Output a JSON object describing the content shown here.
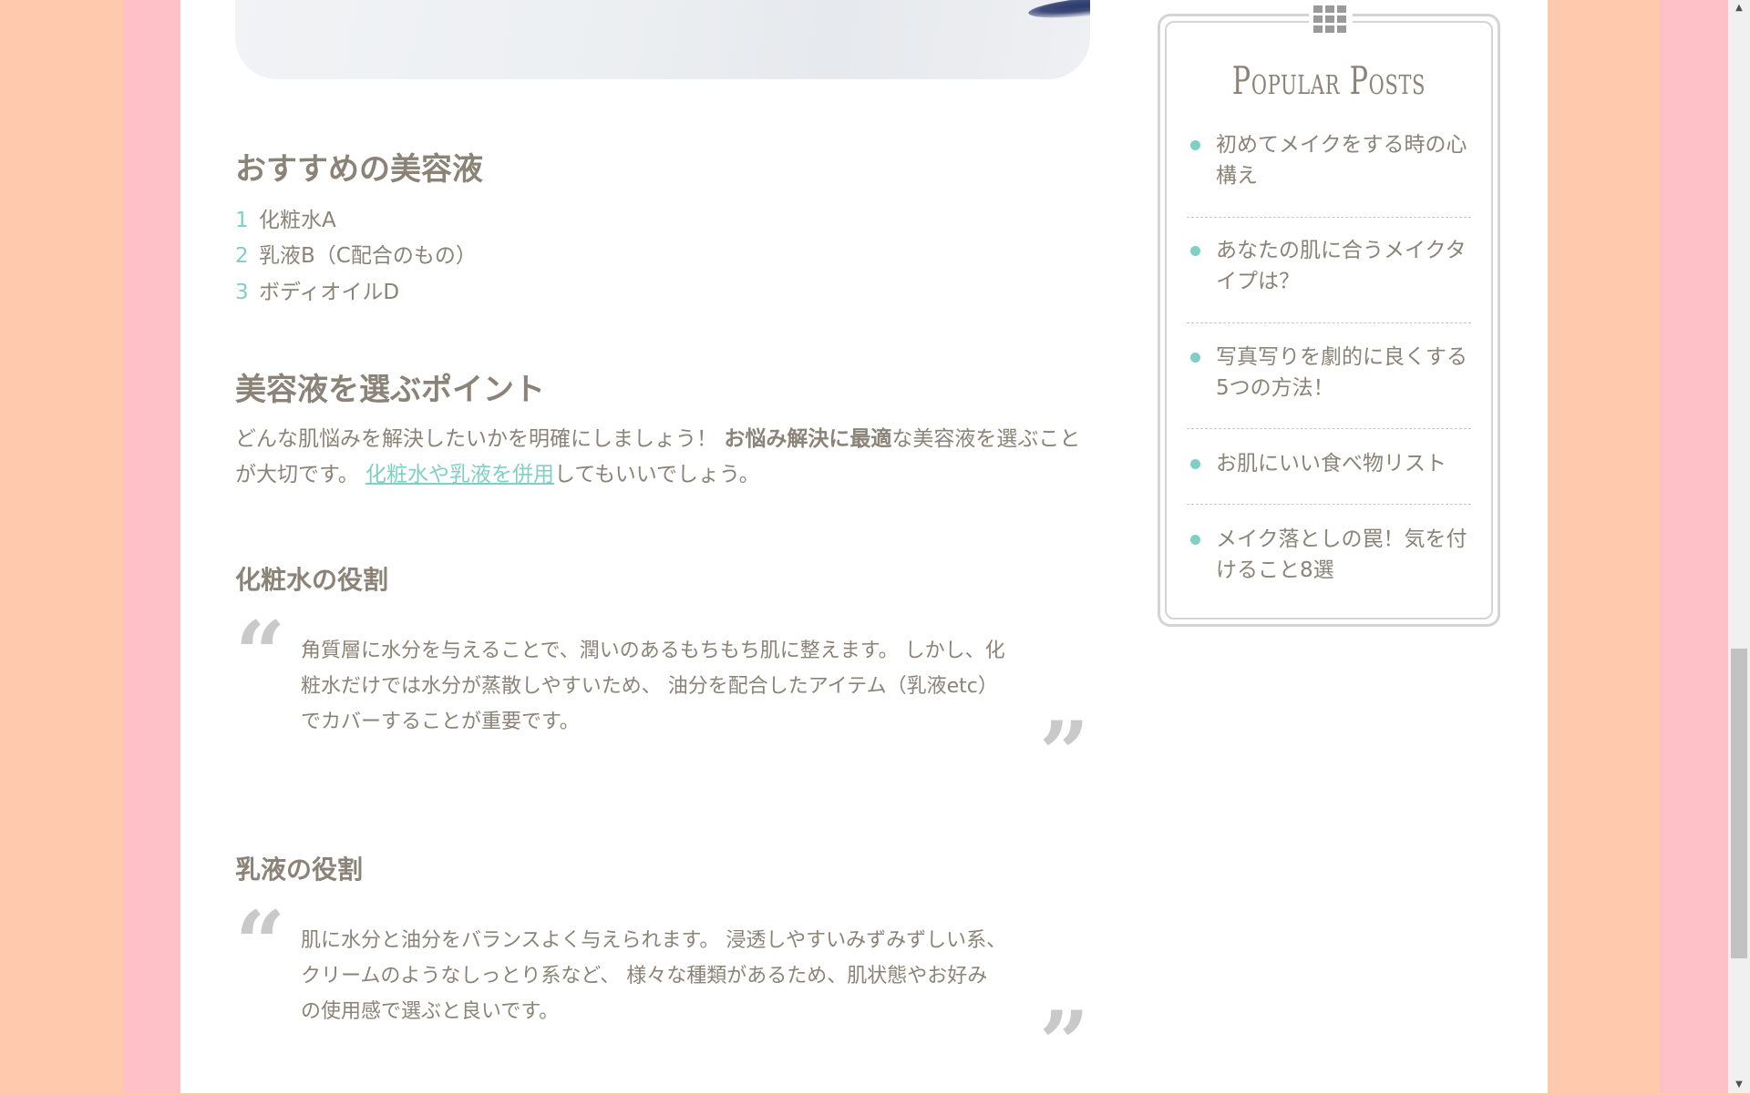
{
  "article": {
    "heading_recommended": "おすすめの美容液",
    "recommended_list": [
      {
        "num": "1",
        "text": "化粧水A"
      },
      {
        "num": "2",
        "text": "乳液B（C配合のもの）"
      },
      {
        "num": "3",
        "text": "ボディオイルD"
      }
    ],
    "heading_points": "美容液を選ぶポイント",
    "points_paragraph": {
      "text_1": "どんな肌悩みを解決したいかを明確にしましょう！ ",
      "bold": "お悩み解決に最適",
      "text_2": "な美容液を選ぶことが大切です。 ",
      "link": "化粧水や乳液を併用",
      "text_3": "してもいいでしょう。"
    },
    "heading_toner": "化粧水の役割",
    "quote_toner": "角質層に水分を与えることで、潤いのあるもちもち肌に整えます。 しかし、化粧水だけでは水分が蒸散しやすいため、 油分を配合したアイテム（乳液etc）でカバーすることが重要です。",
    "heading_emulsion": "乳液の役割",
    "quote_emulsion": "肌に水分と油分をバランスよく与えられます。 浸透しやすいみずみずしい系、クリームのようなしっとり系など、 様々な種類があるため、肌状態やお好みの使用感で選ぶと良いです。",
    "quote_open_glyph": "“",
    "quote_close_glyph": "”"
  },
  "sidebar": {
    "widget_icon": "grid-icon",
    "title": "Popular Posts",
    "posts": [
      "初めてメイクをする時の心構え",
      "あなたの肌に合うメイクタイプは？",
      "写真写りを劇的に良くする5つの方法！",
      "お肌にいい食べ物リスト",
      "メイク落としの罠！気を付けること8選"
    ]
  },
  "scrollbar": {
    "up_arrow": "▲",
    "down_arrow": "▼"
  },
  "colors": {
    "background_peach": "#ffc9ae",
    "background_pink": "#fec1c8",
    "accent_teal": "#7fcfc6",
    "text": "#8b8377",
    "quote_mark": "#c9c9c9"
  }
}
